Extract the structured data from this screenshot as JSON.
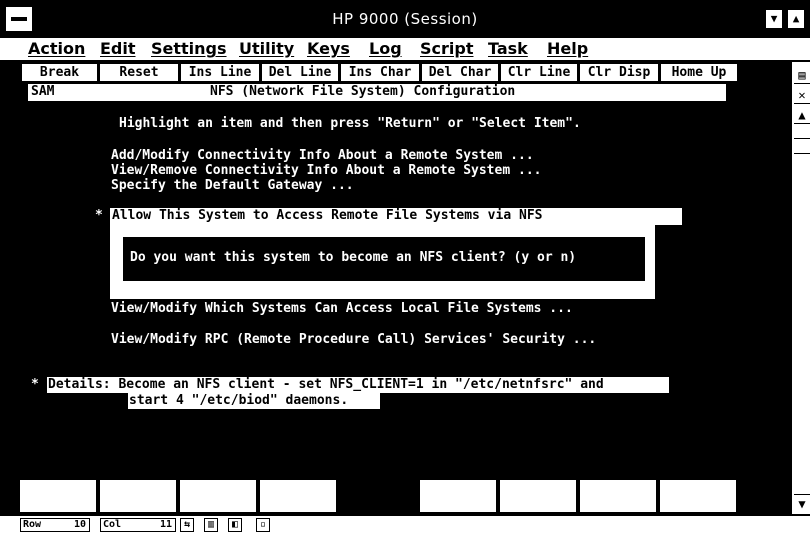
{
  "window": {
    "title": "HP 9000 (Session)",
    "minimize_glyph": "▼",
    "maximize_glyph": "▲"
  },
  "menu": [
    "Action",
    "Edit",
    "Settings",
    "Utility",
    "Keys",
    "Log",
    "Script",
    "Task",
    "Help"
  ],
  "keys": [
    "Break",
    "Reset",
    "Ins Line",
    "Del Line",
    "Ins Char",
    "Del Char",
    "Clr Line",
    "Clr Disp",
    "Home Up"
  ],
  "scroll": {
    "btn1": "▤",
    "btn2": "✕",
    "up": "▲",
    "down": "▼"
  },
  "screen": {
    "header_left": "SAM",
    "header_title": "NFS (Network File System) Configuration",
    "instruction": "Highlight an item and then press \"Return\" or \"Select Item\".",
    "menu_lines": [
      "Add/Modify Connectivity Info About a Remote System ...",
      "View/Remove Connectivity Info About a Remote System ...",
      "Specify the Default Gateway ..."
    ],
    "selected_marker": "*",
    "selected_item": "Allow This System to Access Remote File Systems via NFS",
    "dialog_text": "Do you want this system to become an NFS client? (y or n)",
    "item_local": "View/Modify Which Systems Can Access Local File Systems ...",
    "item_rpc": "View/Modify RPC (Remote Procedure Call) Services' Security ...",
    "details_marker": "*",
    "details_line1": "Details: Become an NFS client - set NFS_CLIENT=1 in \"/etc/netnfsrc\" and",
    "details_line2": "start 4 \"/etc/biod\" daemons."
  },
  "status": {
    "row_label": "Row",
    "row_value": "10",
    "col_label": "Col",
    "col_value": "11"
  }
}
